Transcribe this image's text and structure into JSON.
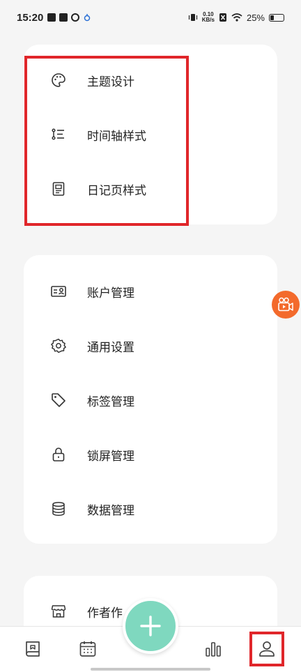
{
  "status_bar": {
    "time": "15:20",
    "speed_top": "0.10",
    "speed_bottom": "KB/s",
    "battery": "25%",
    "battery_level": 0.25
  },
  "appearance_menu": [
    {
      "label": "主题设计",
      "icon": "palette-icon"
    },
    {
      "label": "时间轴样式",
      "icon": "timeline-list-icon"
    },
    {
      "label": "日记页样式",
      "icon": "document-page-icon"
    }
  ],
  "settings_menu": [
    {
      "label": "账户管理",
      "icon": "account-card-icon"
    },
    {
      "label": "通用设置",
      "icon": "gear-icon"
    },
    {
      "label": "标签管理",
      "icon": "tag-icon"
    },
    {
      "label": "锁屏管理",
      "icon": "lock-icon"
    },
    {
      "label": "数据管理",
      "icon": "database-icon"
    }
  ],
  "more_menu": [
    {
      "label": "作者作",
      "icon": "store-icon"
    }
  ],
  "bottom_nav": [
    {
      "name": "journal-tab",
      "icon": "bookmark-book-icon"
    },
    {
      "name": "calendar-tab",
      "icon": "calendar-icon"
    },
    {
      "name": "stats-tab",
      "icon": "bar-chart-icon"
    },
    {
      "name": "profile-tab",
      "icon": "person-icon",
      "selected": true
    }
  ],
  "colors": {
    "accent": "#7fd8bf",
    "highlight": "#e0262a",
    "floating_button": "#f36a2c",
    "background": "#f5f5f5"
  }
}
